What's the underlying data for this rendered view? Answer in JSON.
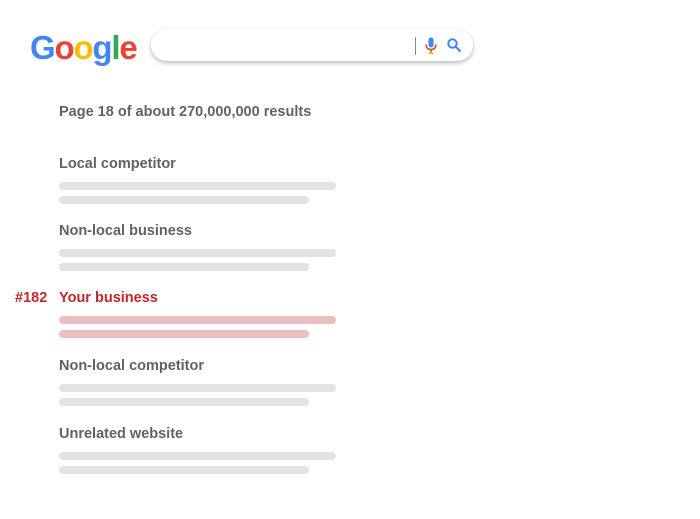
{
  "logo": {
    "letters": [
      "G",
      "o",
      "o",
      "g",
      "l",
      "e"
    ],
    "colors": [
      "#4285F4",
      "#EA4335",
      "#FBBC05",
      "#4285F4",
      "#34A853",
      "#EA4335"
    ]
  },
  "search": {
    "value": "",
    "placeholder": "",
    "mic_icon": "mic-icon",
    "search_icon": "search-icon"
  },
  "results_summary": "Page 18 of about 270,000,000 results",
  "results": [
    {
      "title": "Local competitor"
    },
    {
      "title": "Non-local business"
    },
    {
      "title": "Your business",
      "rank": "#182",
      "highlighted": true
    },
    {
      "title": "Non-local competitor"
    },
    {
      "title": "Unrelated website"
    }
  ],
  "colors": {
    "highlight": "#c1272d",
    "highlight_bar": "#ebbfbf",
    "bar": "#e3e3e3",
    "text": "#5f6368"
  }
}
